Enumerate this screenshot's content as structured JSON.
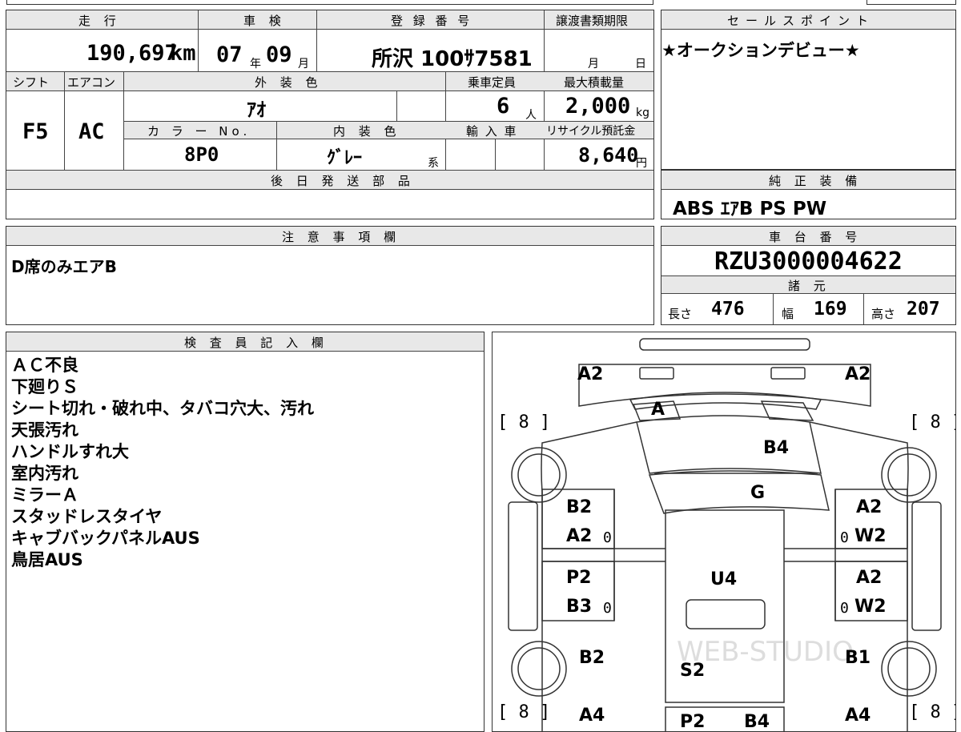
{
  "header": {
    "mileage_label": "走 行",
    "mileage_value": "190,697",
    "mileage_unit": "km",
    "inspection_label": "車 検",
    "inspection_year": "07",
    "inspection_year_unit": "年",
    "inspection_month": "09",
    "inspection_month_unit": "月",
    "registration_label": "登 録 番 号",
    "registration_value": "所沢 100ｻ7581",
    "transfer_label": "譲渡書類期限",
    "transfer_month_unit": "月",
    "transfer_day_unit": "日",
    "sales_label": "セールスポイント",
    "sales_value": "★オークションデビュー★"
  },
  "specs": {
    "shift_label": "シフト",
    "shift_value": "F5",
    "ac_label": "エアコン",
    "ac_value": "AC",
    "exterior_label": "外 装 色",
    "exterior_value": "ｱｵ",
    "capacity_label": "乗車定員",
    "capacity_value": "6",
    "capacity_unit": "人",
    "maxload_label": "最大積載量",
    "maxload_value": "2,000",
    "maxload_unit": "kg",
    "color_no_label": "カ ラ ー No.",
    "color_no_value": "8P0",
    "interior_label": "内 装 色",
    "interior_value": "ｸﾞﾚｰ",
    "interior_unit": "系",
    "import_label": "輸 入 車",
    "recycle_label": "リサイクル預託金",
    "recycle_value": "8,640",
    "recycle_unit": "円",
    "later_parts_label": "後 日 発 送 部 品"
  },
  "equipment": {
    "label": "純 正 装 備",
    "value": "ABS ｴｱB PS PW"
  },
  "notes": {
    "label": "注 意 事 項 欄",
    "value": "D席のみエアB"
  },
  "chassis": {
    "label": "車 台 番 号",
    "value": "RZU3000004622",
    "dims_label": "諸 元",
    "length_label": "長さ",
    "length_value": "476",
    "width_label": "幅",
    "width_value": "169",
    "height_label": "高さ",
    "height_value": "207"
  },
  "inspector": {
    "label": "検 査 員 記 入 欄",
    "lines": [
      "ＡＣ不良",
      "下廻りＳ",
      "シート切れ・破れ中、タバコ穴大、汚れ",
      "天張汚れ",
      "ハンドルすれ大",
      "室内汚れ",
      "ミラーＡ",
      "スタッドレスタイヤ",
      "キャブバックパネルAUS",
      "鳥居AUS"
    ]
  },
  "diagram": {
    "tire_mark": "[ 8 ]",
    "watermark": "WEB-STUDIO",
    "labels": {
      "front_left": "A2",
      "front_right": "A2",
      "windshield": "A",
      "roof_front": "B4",
      "roof_mid": "G",
      "left_door_top_1": "B2",
      "left_door_top_2": "A2",
      "right_door_top_1": "A2",
      "right_door_top_2": "W2",
      "left_door_bot_1": "P2",
      "left_door_bot_2": "B3",
      "right_door_bot_1": "A2",
      "right_door_bot_2": "W2",
      "cargo_center": "U4",
      "rear_left": "B2",
      "rear_right": "B1",
      "cargo_rear": "S2",
      "rear_bottom_left": "A4",
      "rear_bottom_right": "A4",
      "tail_1": "P2",
      "tail_2": "B4",
      "zero": "0"
    }
  }
}
